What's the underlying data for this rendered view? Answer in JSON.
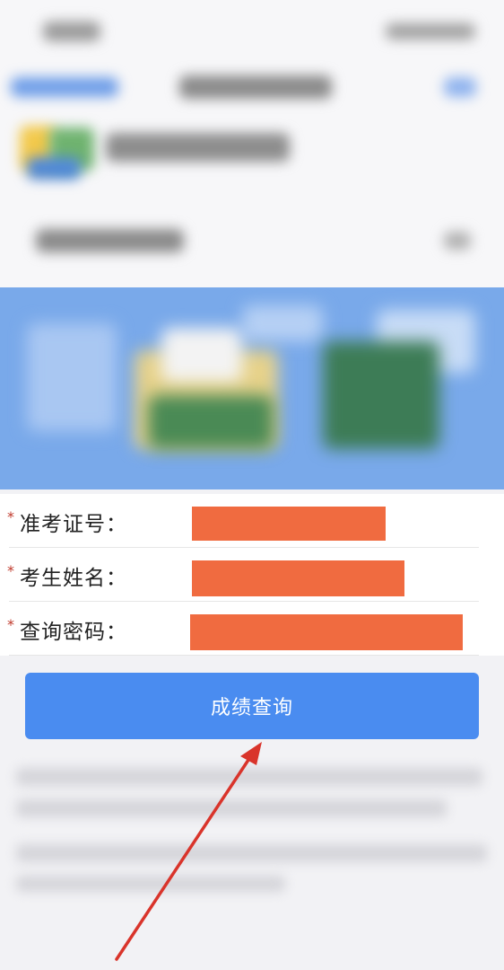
{
  "form": {
    "fields": [
      {
        "required_mark": "*",
        "label": "准考证号："
      },
      {
        "required_mark": "*",
        "label": "考生姓名："
      },
      {
        "required_mark": "*",
        "label": "查询密码："
      }
    ],
    "redaction_color": "#f06b40"
  },
  "query_button": {
    "label": "成绩查询"
  },
  "annotation": {
    "arrow_color": "#d9342b"
  },
  "colors": {
    "accent": "#4a8cf0",
    "banner": "#79a9ea",
    "required_mark": "#c0392b"
  }
}
